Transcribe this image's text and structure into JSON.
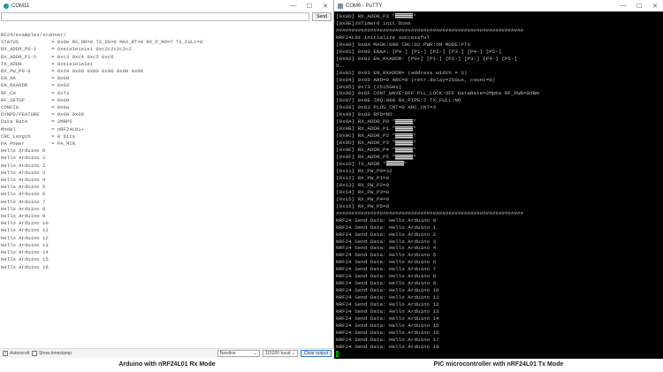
{
  "left": {
    "title": "COM11",
    "send_label": "Send",
    "input_value": "",
    "lines": [
      "RF24/examples/scanner/",
      "STATUS           = 0x0e RX_DR=0 TX_DS=0 MAX_RT=0 RX_P_NO=7 TX_FULL=0",
      "RX_ADDR_P0-1     = 0xe1e1e1e1e1 0xc2c2c2c2c2",
      "RX_ADDR_P2-5     = 0xc3 0xc4 0xc5 0xc6",
      "TX_ADDR          = 0xe1e1e1e1e1",
      "RX_PW_P0-6       = 0x20 0x00 0x00 0x00 0x00 0x00",
      "EN_AA            = 0x00",
      "EN_RXADDR        = 0x03",
      "RF_CH            = 0x73",
      "RF_SETUP         = 0x09",
      "CONFIG           = 0x0a",
      "DYNPD/FEATURE    = 0x00 0x00",
      "Data Rate        = 2MBPS",
      "Model            = nRF24L01+",
      "CRC Length       = 8 bits",
      "PA Power         = PA_MIN",
      "Hello Arduino 0",
      "Hello Arduino 1",
      "Hello Arduino 2",
      "Hello Arduino 3",
      "Hello Arduino 4",
      "Hello Arduino 5",
      "Hello Arduino 6",
      "Hello Arduino 7",
      "Hello Arduino 8",
      "Hello Arduino 9",
      "Hello Arduino 10",
      "Hello Arduino 11",
      "Hello Arduino 12",
      "Hello Arduino 13",
      "Hello Arduino 14",
      "Hello Arduino 15",
      "Hello Arduino 16"
    ],
    "autoscroll_label": "Autoscroll",
    "autoscroll_checked": true,
    "timestamp_label": "Show timestamp",
    "timestamp_checked": false,
    "line_ending": "Newline",
    "baud": "115200 baud",
    "clear_label": "Clear output",
    "caption": "Arduino with nRF24L01 Rx Mode"
  },
  "right": {
    "title": "COM6 - PuTTY",
    "lines": [
      {
        "pre": "[0x0D] RX_ADDR_P3 \"",
        "mask": true,
        "post": "\""
      },
      {
        "pre": "[0x0E]≡≡Timer0 init Done"
      },
      {
        "pre": "############################################################"
      },
      {
        "pre": "NRF24L01 initialize successful"
      },
      {
        "pre": "[0x00] 0x0A MASK:000 CRC:02 PWR:ON MODE:PTX"
      },
      {
        "pre": "[0x01] 0x00 ENAA: [P0-] [P1-] [P2-] [P3-] [P4-] [P5-]"
      },
      {
        "pre": "[0x02] 0x01 EN_RXADDR: [P0+] [P1-] [P2-] [P3-] [P4-] [P5-]"
      },
      {
        "pre": "5.."
      },
      {
        "pre": "[0x03] 0x03 EN_RXADDR= (address width = 3)"
      },
      {
        "pre": "[0x04] 0x00 ARD=0 ARC=0 (retr.delay=250us, count=0)"
      },
      {
        "pre": "[0x05] 0x73 (2515GHz)"
      },
      {
        "pre": "[0x06] 0x0F CONT_WAVE:OFF PLL_LOCK:OFF DataRate=2Mpbs RF_PWR=0dBm"
      },
      {
        "pre": "[0x07] 0x0E IRQ:000 RX_PIPE:7 TX_FULL:NO"
      },
      {
        "pre": "[0x08] 0x03 PLOS_CNT=0 ARC_CNT=3"
      },
      {
        "pre": "[0x09] 0x00 RPD=NO"
      },
      {
        "pre": "[0x0A] RX_ADDR_P0 \"",
        "mask": true,
        "post": "\""
      },
      {
        "pre": "[0x0B] RX_ADDR_P1 \"",
        "mask": true,
        "post": "\""
      },
      {
        "pre": "[0x0C] RX_ADDR_P2 \"",
        "mask": true,
        "post": "\""
      },
      {
        "pre": "[0x0D] RX_ADDR_P3 \"",
        "mask": true,
        "post": "\""
      },
      {
        "pre": "[0x0E] RX_ADDR_P4 \"",
        "mask": true,
        "post": "\""
      },
      {
        "pre": "[0x0F] RX_ADDR_P5 \"",
        "mask": true,
        "post": "\""
      },
      {
        "pre": "[0x10] TX_ADDR \"",
        "mask": true,
        "post": "\""
      },
      {
        "pre": "[0x11] RX_PW_P0=32"
      },
      {
        "pre": "[0x12] RX_PW_P1=0"
      },
      {
        "pre": "[0x13] RX_PW_P2=0"
      },
      {
        "pre": "[0x14] RX_PW_P3=0"
      },
      {
        "pre": "[0x15] RX_PW_P4=0"
      },
      {
        "pre": "[0x16] RX_PW_P5=0"
      },
      {
        "pre": "############################################################"
      },
      {
        "pre": "NRF24 Send Data: Hello Arduino 0"
      },
      {
        "pre": "NRF24 Send Data: Hello Arduino 1"
      },
      {
        "pre": "NRF24 Send Data: Hello Arduino 2"
      },
      {
        "pre": "NRF24 Send Data: Hello Arduino 3"
      },
      {
        "pre": "NRF24 Send Data: Hello Arduino 4"
      },
      {
        "pre": "NRF24 Send Data: Hello Arduino 5"
      },
      {
        "pre": "NRF24 Send Data: Hello Arduino 6"
      },
      {
        "pre": "NRF24 Send Data: Hello Arduino 7"
      },
      {
        "pre": "NRF24 Send Data: Hello Arduino 8"
      },
      {
        "pre": "NRF24 Send Data: Hello Arduino 9"
      },
      {
        "pre": "NRF24 Send Data: Hello Arduino 10"
      },
      {
        "pre": "NRF24 Send Data: Hello Arduino 11"
      },
      {
        "pre": "NRF24 Send Data: Hello Arduino 12"
      },
      {
        "pre": "NRF24 Send Data: Hello Arduino 13"
      },
      {
        "pre": "NRF24 Send Data: Hello Arduino 14"
      },
      {
        "pre": "NRF24 Send Data: Hello Arduino 15"
      },
      {
        "pre": "NRF24 Send Data: Hello Arduino 16"
      },
      {
        "pre": "NRF24 Send Data: Hello Arduino 17"
      },
      {
        "pre": "NRF24 Send Data: Hello Arduino 18"
      }
    ],
    "caption": "PIC microcontroller with nRF24L01 Tx Mode"
  }
}
